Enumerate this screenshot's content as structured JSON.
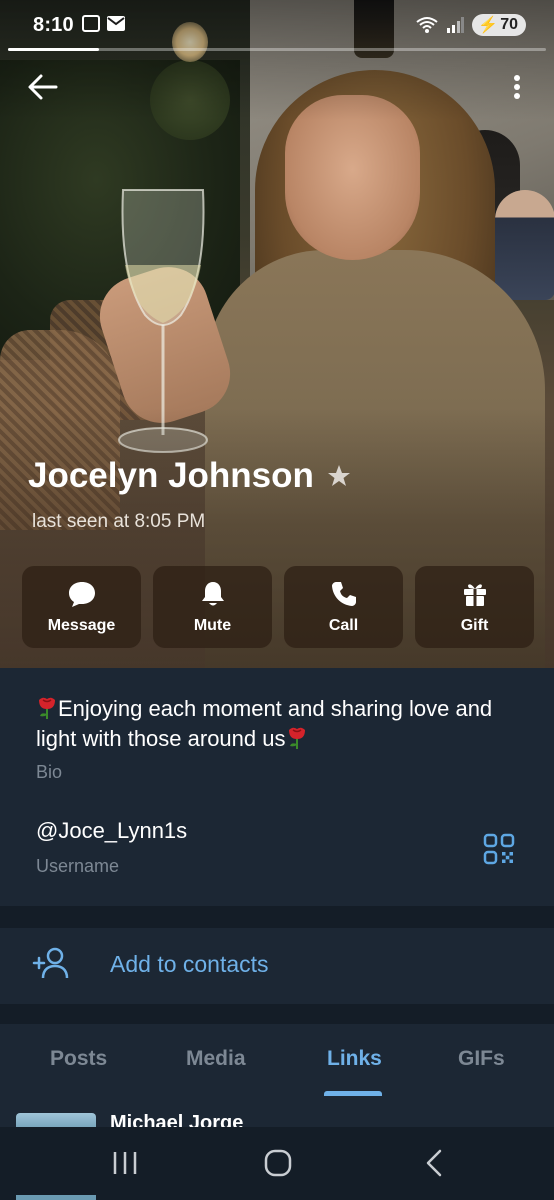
{
  "status_bar": {
    "time": "8:10",
    "battery": "70",
    "story_progress_percent": 17
  },
  "profile": {
    "name": "Jocelyn Johnson",
    "last_seen": "last seen at 8:05 PM"
  },
  "actions": [
    {
      "label": "Message",
      "icon": "message-icon"
    },
    {
      "label": "Mute",
      "icon": "bell-icon"
    },
    {
      "label": "Call",
      "icon": "phone-icon"
    },
    {
      "label": "Gift",
      "icon": "gift-icon"
    }
  ],
  "info": {
    "bio": "Enjoying each moment and sharing love and light with those around us",
    "bio_caption": "Bio",
    "username": "@Joce_Lynn1s",
    "username_caption": "Username"
  },
  "contacts": {
    "add_label": "Add to contacts"
  },
  "tabs": [
    {
      "label": "Posts",
      "active": false
    },
    {
      "label": "Media",
      "active": false
    },
    {
      "label": "Links",
      "active": true
    },
    {
      "label": "GIFs",
      "active": false
    }
  ],
  "list": {
    "first_item_title": "Michael Jorge"
  },
  "colors": {
    "accent": "#6fb1e8",
    "panel": "#1c2734",
    "muted": "#7d8894"
  }
}
